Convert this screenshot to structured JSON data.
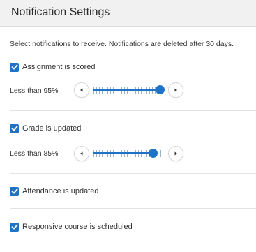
{
  "header": {
    "title": "Notification Settings"
  },
  "intro_text": "Select notifications to receive. Notifications are deleted after 30 days.",
  "items": [
    {
      "label": "Assignment is scored",
      "checked": true,
      "threshold": {
        "label": "Less than 95%",
        "value_percent": 95
      }
    },
    {
      "label": "Grade is updated",
      "checked": true,
      "threshold": {
        "label": "Less than 85%",
        "value_percent": 85
      }
    },
    {
      "label": "Attendance is updated",
      "checked": true
    },
    {
      "label": "Responsive course is scheduled",
      "checked": true
    }
  ],
  "colors": {
    "accent": "#1f73c6",
    "header_bg": "#f1f1f1",
    "divider": "#e3e3e3"
  },
  "icons": {
    "checkbox": "checkmark-icon",
    "decrease": "caret-left-icon",
    "increase": "caret-right-icon"
  }
}
